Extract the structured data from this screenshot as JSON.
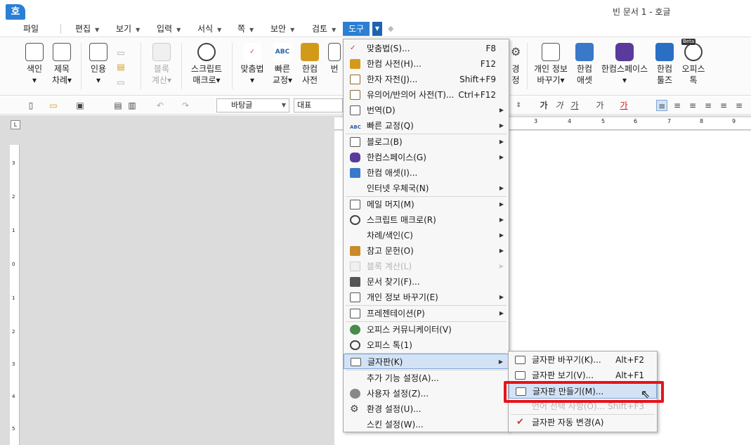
{
  "window": {
    "logo": "호",
    "title": "빈 문서 1 - 호글"
  },
  "menubar": {
    "items": [
      {
        "label": "파일",
        "has_arrow": false
      },
      {
        "label": "편집",
        "has_arrow": true
      },
      {
        "label": "보기",
        "has_arrow": true
      },
      {
        "label": "입력",
        "has_arrow": true
      },
      {
        "label": "서식",
        "has_arrow": true
      },
      {
        "label": "쪽",
        "has_arrow": true
      },
      {
        "label": "보안",
        "has_arrow": true
      },
      {
        "label": "검토",
        "has_arrow": true
      },
      {
        "label": "도구",
        "has_arrow": true,
        "active": true
      }
    ],
    "active_color": "#2b7fd4"
  },
  "ribbon": {
    "buttons": [
      {
        "label1": "색인",
        "label2": "▾",
        "icon": "index-icon"
      },
      {
        "label1": "제목",
        "label2": "차례▾",
        "icon": "toc-icon"
      },
      {
        "label1": "인용",
        "label2": "▾",
        "icon": "quote-icon"
      },
      {
        "label1": "블록",
        "label2": "계산▾",
        "icon": "block-calc-icon",
        "disabled": true
      },
      {
        "label1": "스크립트",
        "label2": "매크로▾",
        "icon": "script-macro-icon"
      },
      {
        "label1": "맞춤법",
        "label2": "▾",
        "icon": "spellcheck-icon"
      },
      {
        "label1": "빠른",
        "label2": "교정▾",
        "icon": "quick-correct-icon"
      },
      {
        "label1": "한컴",
        "label2": "사전",
        "icon": "hancom-dictionary-icon"
      },
      {
        "label1": "번",
        "label2": "",
        "icon": "translate-icon"
      },
      {
        "label1": "경",
        "label2": "정",
        "icon": "gear-icon"
      },
      {
        "label1": "개인 정보",
        "label2": "바꾸기▾",
        "icon": "privacy-icon"
      },
      {
        "label1": "한컴",
        "label2": "애셋",
        "icon": "hancom-asset-icon"
      },
      {
        "label1": "한컴스페이스",
        "label2": "▾",
        "icon": "hancom-space-icon"
      },
      {
        "label1": "한컴",
        "label2": "툴즈",
        "icon": "hancom-tools-icon"
      },
      {
        "label1": "오피스",
        "label2": "톡",
        "icon": "office-talk-icon",
        "badge": "Beta"
      }
    ]
  },
  "toolbar2": {
    "style_select": "바탕글",
    "font_select": "대표",
    "format_buttons": [
      "가",
      "가",
      "가",
      "가",
      "가"
    ]
  },
  "ruler": {
    "h_ticks": [
      "3",
      "4",
      "5",
      "6",
      "7",
      "8",
      "9"
    ],
    "v_ticks": [
      "3",
      "2",
      "1",
      "0",
      "1",
      "2",
      "3",
      "4",
      "5"
    ]
  },
  "tools_menu": {
    "items": [
      {
        "label": "맞춤법(S)...",
        "shortcut": "F8",
        "icon": "spellcheck-icon",
        "icon_color": "#c43b3b"
      },
      {
        "label": "한컴 사전(H)...",
        "shortcut": "F12",
        "icon": "hancom-dictionary-icon",
        "icon_color": "#d39a1a"
      },
      {
        "label": "한자 자전(J)...",
        "shortcut": "Shift+F9",
        "icon": "hanja-dictionary-icon",
        "icon_color": "#8a6a3a"
      },
      {
        "label": "유의어/반의어 사전(T)...",
        "shortcut": "Ctrl+F12",
        "icon": "thesaurus-icon",
        "icon_color": "#8a6a3a"
      },
      {
        "label": "번역(D)",
        "submenu": true,
        "icon": "translate-icon",
        "icon_color": "#555555"
      },
      {
        "label": "빠른 교정(Q)",
        "submenu": true,
        "icon": "quick-correct-icon",
        "icon_color": "#d39a1a"
      },
      {
        "sep": true
      },
      {
        "label": "블로그(B)",
        "submenu": true,
        "icon": "blog-icon",
        "icon_color": "#555555"
      },
      {
        "label": "한컴스페이스(G)",
        "submenu": true,
        "icon": "hancom-space-icon",
        "icon_color": "#5a3a9c"
      },
      {
        "label": "한컴 애셋(I)...",
        "icon": "hancom-asset-icon",
        "icon_color": "#3a78c9"
      },
      {
        "label": "인터넷 우체국(N)",
        "submenu": true,
        "icon": "",
        "icon_color": ""
      },
      {
        "sep": true
      },
      {
        "label": "메일 머지(M)",
        "submenu": true,
        "icon": "mail-icon",
        "icon_color": "#555555"
      },
      {
        "label": "스크립트 매크로(R)",
        "submenu": true,
        "icon": "script-macro-icon",
        "icon_color": "#555555"
      },
      {
        "label": "차례/색인(C)",
        "submenu": true,
        "icon": "",
        "icon_color": ""
      },
      {
        "label": "참고 문헌(O)",
        "submenu": true,
        "icon": "reference-icon",
        "icon_color": "#c98a2a"
      },
      {
        "label": "블록 계산(L)",
        "submenu": true,
        "disabled": true,
        "icon": "block-calc-icon",
        "icon_color": "#cccccc"
      },
      {
        "label": "문서 찾기(F)...",
        "icon": "find-document-icon",
        "icon_color": "#555555"
      },
      {
        "label": "개인 정보 바꾸기(E)",
        "submenu": true,
        "icon": "privacy-icon",
        "icon_color": "#555555"
      },
      {
        "sep": true
      },
      {
        "label": "프레젠테이션(P)",
        "submenu": true,
        "icon": "presentation-icon",
        "icon_color": "#555555"
      },
      {
        "sep": true
      },
      {
        "label": "오피스 커뮤니케이터(V)",
        "icon": "office-communicator-icon",
        "icon_color": "#4a8a4a"
      },
      {
        "label": "오피스 톡(1)",
        "icon": "office-talk-icon",
        "icon_color": "#555555"
      },
      {
        "sep": true
      },
      {
        "label": "글자판(K)",
        "submenu": true,
        "active": true,
        "icon": "keyboard-icon",
        "icon_color": "#555555"
      },
      {
        "sep": true
      },
      {
        "label": "추가 기능 설정(A)...",
        "icon": "",
        "icon_color": ""
      },
      {
        "label": "사용자 설정(Z)...",
        "icon": "user-settings-icon",
        "icon_color": "#666666"
      },
      {
        "label": "환경 설정(U)...",
        "icon": "gear-icon",
        "icon_color": "#444444"
      },
      {
        "label": "스킨 설정(W)...",
        "icon": "",
        "icon_color": ""
      }
    ]
  },
  "keyboard_submenu": {
    "items": [
      {
        "label": "글자판 바꾸기(K)...",
        "shortcut": "Alt+F2",
        "icon": "keyboard-switch-icon"
      },
      {
        "label": "글자판 보기(V)...",
        "shortcut": "Alt+F1",
        "icon": "keyboard-view-icon"
      },
      {
        "label": "글자판 만들기(M)...",
        "shortcut": "",
        "icon": "keyboard-create-icon",
        "active": true
      },
      {
        "label": "언어 선택 사항(O)...",
        "shortcut": "Shift+F3",
        "icon": "",
        "disabled": true
      },
      {
        "label": "글자판 자동 변경(A)",
        "shortcut": "",
        "icon": "checkmark-icon",
        "checked": true
      }
    ],
    "highlight_color": "#e8121a"
  }
}
